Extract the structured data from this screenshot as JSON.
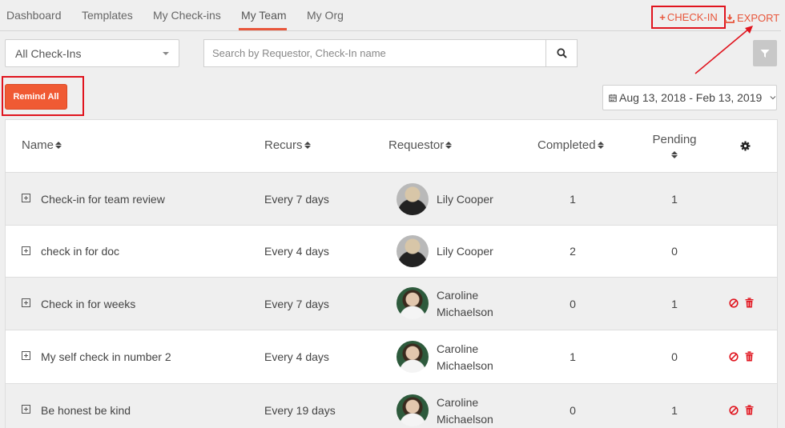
{
  "tabs": [
    "Dashboard",
    "Templates",
    "My Check-ins",
    "My Team",
    "My Org"
  ],
  "active_tab": "My Team",
  "header_actions": {
    "checkin_label": "CHECK-IN",
    "export_label": "EXPORT"
  },
  "filter": {
    "selected": "All Check-Ins",
    "search_placeholder": "Search by Requestor, Check-In name"
  },
  "remind_all_label": "Remind All",
  "date_range": "Aug 13, 2018 - Feb 13, 2019",
  "table": {
    "columns": {
      "name": "Name",
      "recurs": "Recurs",
      "requestor": "Requestor",
      "completed": "Completed",
      "pending": "Pending"
    },
    "rows": [
      {
        "name": "Check-in for team review",
        "recurs": "Every 7 days",
        "requestor_line1": "Lily Cooper",
        "requestor_line2": "",
        "completed": "1",
        "pending": "1"
      },
      {
        "name": "check in for doc",
        "recurs": "Every 4 days",
        "requestor_line1": "Lily Cooper",
        "requestor_line2": "",
        "completed": "2",
        "pending": "0"
      },
      {
        "name": "Check in for weeks",
        "recurs": "Every 7 days",
        "requestor_line1": "Caroline",
        "requestor_line2": "Michaelson",
        "completed": "0",
        "pending": "1"
      },
      {
        "name": "My self check in number 2",
        "recurs": "Every 4 days",
        "requestor_line1": "Caroline",
        "requestor_line2": "Michaelson",
        "completed": "1",
        "pending": "0"
      },
      {
        "name": "Be honest be kind",
        "recurs": "Every 19 days",
        "requestor_line1": "Caroline",
        "requestor_line2": "Michaelson",
        "completed": "0",
        "pending": "1"
      }
    ]
  },
  "colors": {
    "accent": "#e8563b",
    "annotation": "#e0141e",
    "button": "#f05a33"
  }
}
